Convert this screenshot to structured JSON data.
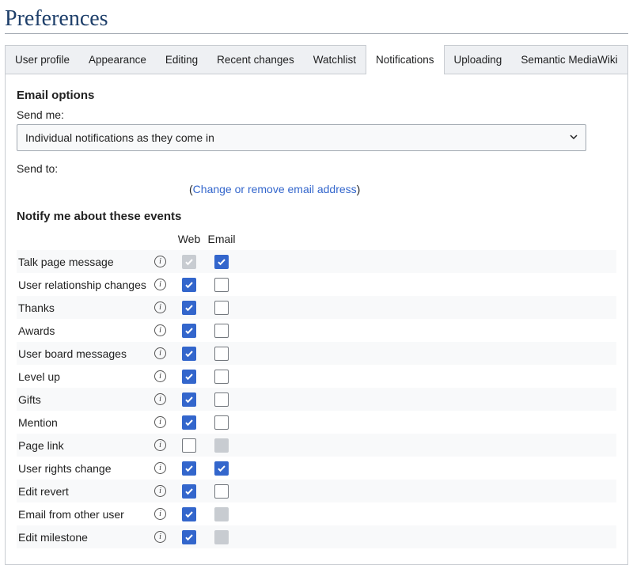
{
  "title": "Preferences",
  "tabs": [
    {
      "label": "User profile",
      "active": false
    },
    {
      "label": "Appearance",
      "active": false
    },
    {
      "label": "Editing",
      "active": false
    },
    {
      "label": "Recent changes",
      "active": false
    },
    {
      "label": "Watchlist",
      "active": false
    },
    {
      "label": "Notifications",
      "active": true
    },
    {
      "label": "Uploading",
      "active": false
    },
    {
      "label": "Semantic MediaWiki",
      "active": false
    }
  ],
  "emailOptions": {
    "heading": "Email options",
    "sendMeLabel": "Send me:",
    "sendMeValue": "Individual notifications as they come in",
    "sendToLabel": "Send to:",
    "changeLinkText": "Change or remove email address"
  },
  "events": {
    "heading": "Notify me about these events",
    "columns": {
      "web": "Web",
      "email": "Email"
    },
    "rows": [
      {
        "label": "Talk page message",
        "web": "disabled-checked",
        "email": "checked"
      },
      {
        "label": "User relationship changes",
        "web": "checked",
        "email": "unchecked"
      },
      {
        "label": "Thanks",
        "web": "checked",
        "email": "unchecked"
      },
      {
        "label": "Awards",
        "web": "checked",
        "email": "unchecked"
      },
      {
        "label": "User board messages",
        "web": "checked",
        "email": "unchecked"
      },
      {
        "label": "Level up",
        "web": "checked",
        "email": "unchecked"
      },
      {
        "label": "Gifts",
        "web": "checked",
        "email": "unchecked"
      },
      {
        "label": "Mention",
        "web": "checked",
        "email": "unchecked"
      },
      {
        "label": "Page link",
        "web": "unchecked",
        "email": "disabled-unchecked"
      },
      {
        "label": "User rights change",
        "web": "checked",
        "email": "checked"
      },
      {
        "label": "Edit revert",
        "web": "checked",
        "email": "unchecked"
      },
      {
        "label": "Email from other user",
        "web": "checked",
        "email": "disabled-unchecked"
      },
      {
        "label": "Edit milestone",
        "web": "checked",
        "email": "disabled-unchecked"
      }
    ]
  }
}
